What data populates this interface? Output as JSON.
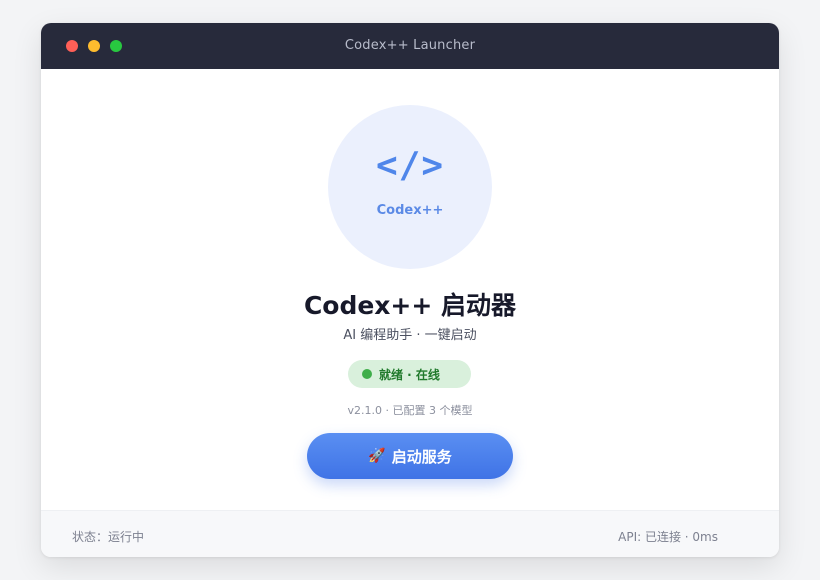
{
  "window": {
    "title": "Codex++ Launcher"
  },
  "logo": {
    "glyph": "</>",
    "text": "Codex++"
  },
  "main": {
    "title": "Codex++ 启动器",
    "subtitle": "AI 编程助手 · 一键启动",
    "status_label": "就绪 · 在线",
    "version_info": "v2.1.0 · 已配置 3 个模型",
    "launch_icon": "🚀",
    "launch_label": "启动服务"
  },
  "footer": {
    "status": "状态：运行中",
    "api": "API: 已连接 · 0ms"
  },
  "colors": {
    "accent": "#4a7fec",
    "status_green": "#3fae4a",
    "titlebar": "#272a3b"
  },
  "icons": {
    "close": "close-dot",
    "minimize": "minimize-dot",
    "maximize": "maximize-dot",
    "launch": "rocket-icon",
    "status": "online-indicator"
  }
}
